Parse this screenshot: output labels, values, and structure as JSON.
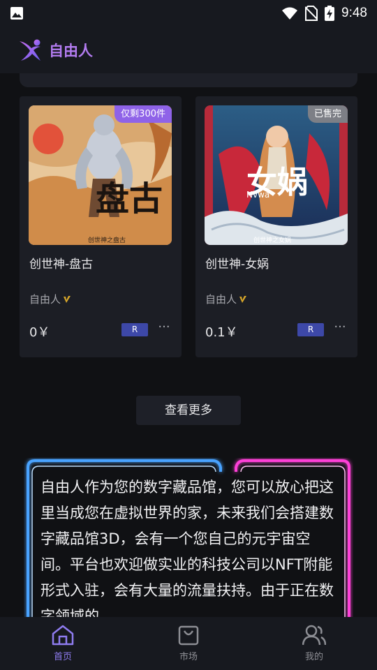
{
  "status_bar": {
    "time": "9:48"
  },
  "header": {
    "brand_name": "自由人"
  },
  "cards": [
    {
      "name": "创世神-盘古",
      "badge": "仅剩300件",
      "badge_color": "#8f63e8",
      "creator": "自由人",
      "price": "0￥",
      "tag": "R",
      "more": "···",
      "art_title": "盘古",
      "art_subtitle": "创世神之盘古"
    },
    {
      "name": "创世神-女娲",
      "badge": "已售完",
      "badge_color": "#7d7f86",
      "creator": "自由人",
      "price": "0.1￥",
      "tag": "R",
      "more": "···",
      "art_title": "女娲",
      "art_subtitle": "创世神之女娲",
      "art_logo": "Nvwa"
    }
  ],
  "view_more": "查看更多",
  "intro": {
    "text": "自由人作为您的数字藏品馆，您可以放心把这里当成您在虚拟世界的家，未来我们会搭建数字藏品馆3D，会有一个您自己的元宇宙空间。平台也欢迎做实业的科技公司以NFT附能形式入驻，会有大量的流量扶持。由于正在数字领域的"
  },
  "nav": [
    {
      "label": "首页",
      "icon": "home-icon",
      "active": true
    },
    {
      "label": "市场",
      "icon": "market-bag-icon",
      "active": false
    },
    {
      "label": "我的",
      "icon": "profile-icon",
      "active": false
    }
  ],
  "colors": {
    "accent": "#8f7cf0",
    "brand": "#b37cf0",
    "neon_blue": "#4aa3ff",
    "neon_pink": "#ff3fd8"
  }
}
